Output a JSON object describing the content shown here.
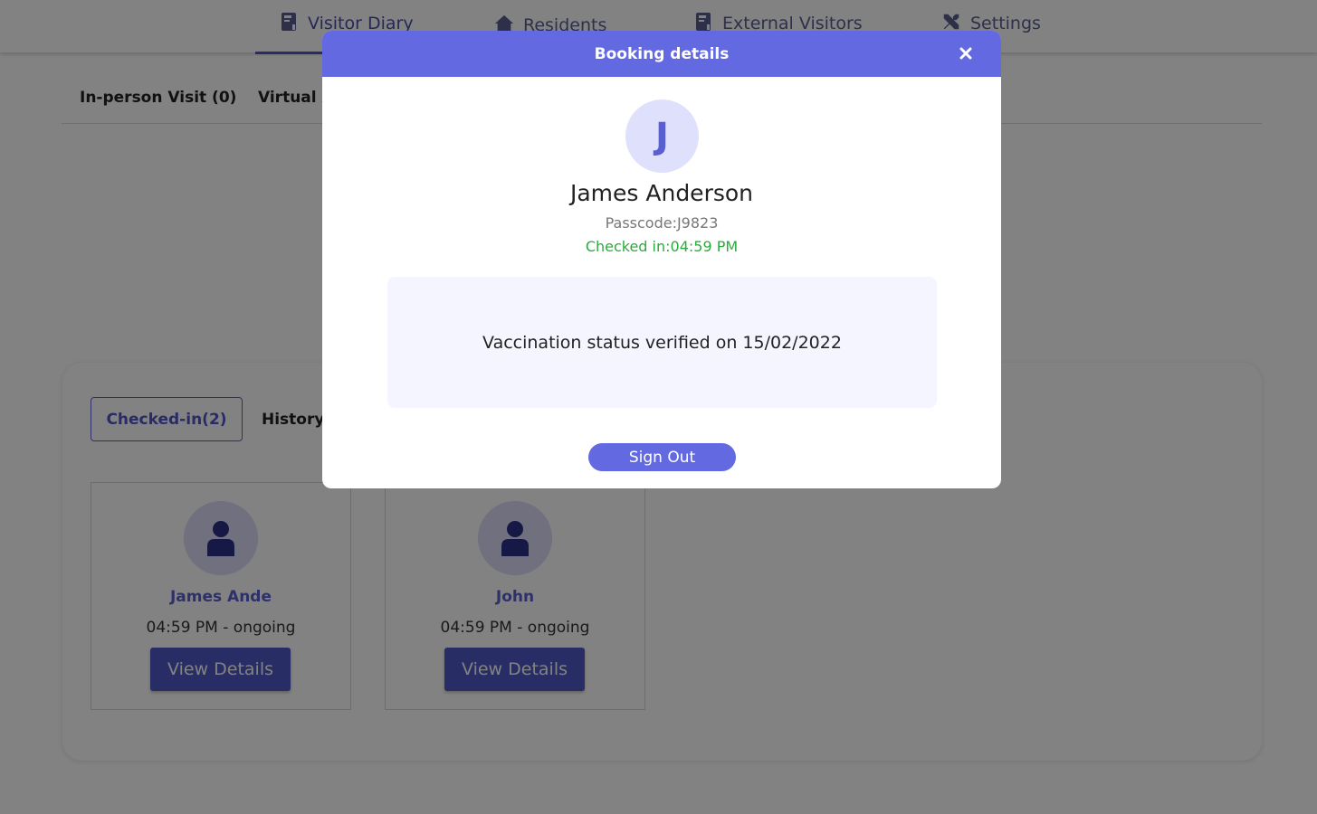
{
  "nav": {
    "items": [
      {
        "label": "Visitor Diary",
        "icon": "book-icon",
        "active": true
      },
      {
        "label": "Residents",
        "icon": "house-icon",
        "active": false
      },
      {
        "label": "External Visitors",
        "icon": "book-icon",
        "active": false
      },
      {
        "label": "Settings",
        "icon": "tools-icon",
        "active": false
      }
    ]
  },
  "subtabs": {
    "items": [
      "In-person Visit (0)",
      "Virtual A"
    ]
  },
  "panel": {
    "tabs": {
      "checked_in": "Checked-in(2)",
      "history": "History("
    },
    "cards": [
      {
        "name": "James Ande",
        "time": "04:59 PM - ongoing",
        "button": "View Details"
      },
      {
        "name": "John",
        "time": "04:59 PM - ongoing",
        "button": "View Details"
      }
    ]
  },
  "modal": {
    "title": "Booking details",
    "close_glyph": "×",
    "avatar_initial": "J",
    "name": "James Anderson",
    "passcode": "Passcode:J9823",
    "checked_in": "Checked in:04:59 PM",
    "vaccination": "Vaccination status verified on 15/02/2022",
    "sign_out": "Sign Out"
  },
  "colors": {
    "accent": "#6369e0",
    "accent_dark": "#5258c9",
    "success": "#2bab3c",
    "overlay": "rgba(0,0,0,0.49)"
  }
}
